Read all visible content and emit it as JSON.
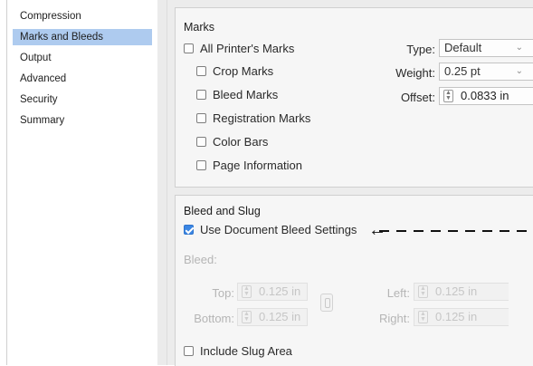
{
  "sidebar": {
    "items": [
      {
        "label": "Compression",
        "selected": false
      },
      {
        "label": "Marks and Bleeds",
        "selected": true
      },
      {
        "label": "Output",
        "selected": false
      },
      {
        "label": "Advanced",
        "selected": false
      },
      {
        "label": "Security",
        "selected": false
      },
      {
        "label": "Summary",
        "selected": false
      }
    ]
  },
  "marks": {
    "title": "Marks",
    "all_printers_marks": {
      "label": "All Printer's Marks",
      "checked": false
    },
    "crop_marks": {
      "label": "Crop Marks",
      "checked": false
    },
    "bleed_marks": {
      "label": "Bleed Marks",
      "checked": false
    },
    "registration_marks": {
      "label": "Registration Marks",
      "checked": false
    },
    "color_bars": {
      "label": "Color Bars",
      "checked": false
    },
    "page_information": {
      "label": "Page Information",
      "checked": false
    },
    "type": {
      "label": "Type:",
      "value": "Default"
    },
    "weight": {
      "label": "Weight:",
      "value": "0.25 pt"
    },
    "offset": {
      "label": "Offset:",
      "value": "0.0833 in"
    }
  },
  "bleed_slug": {
    "title": "Bleed and Slug",
    "use_document_bleed": {
      "label": "Use Document Bleed Settings",
      "checked": true
    },
    "bleed_label": "Bleed:",
    "top": {
      "label": "Top:",
      "value": "0.125 in"
    },
    "bottom": {
      "label": "Bottom:",
      "value": "0.125 in"
    },
    "left": {
      "label": "Left:",
      "value": "0.125 in"
    },
    "right": {
      "label": "Right:",
      "value": "0.125 in"
    },
    "include_slug": {
      "label": "Include Slug Area",
      "checked": false
    }
  },
  "colors": {
    "selection": "#aecbef",
    "checkbox_accent": "#3b86e3"
  }
}
